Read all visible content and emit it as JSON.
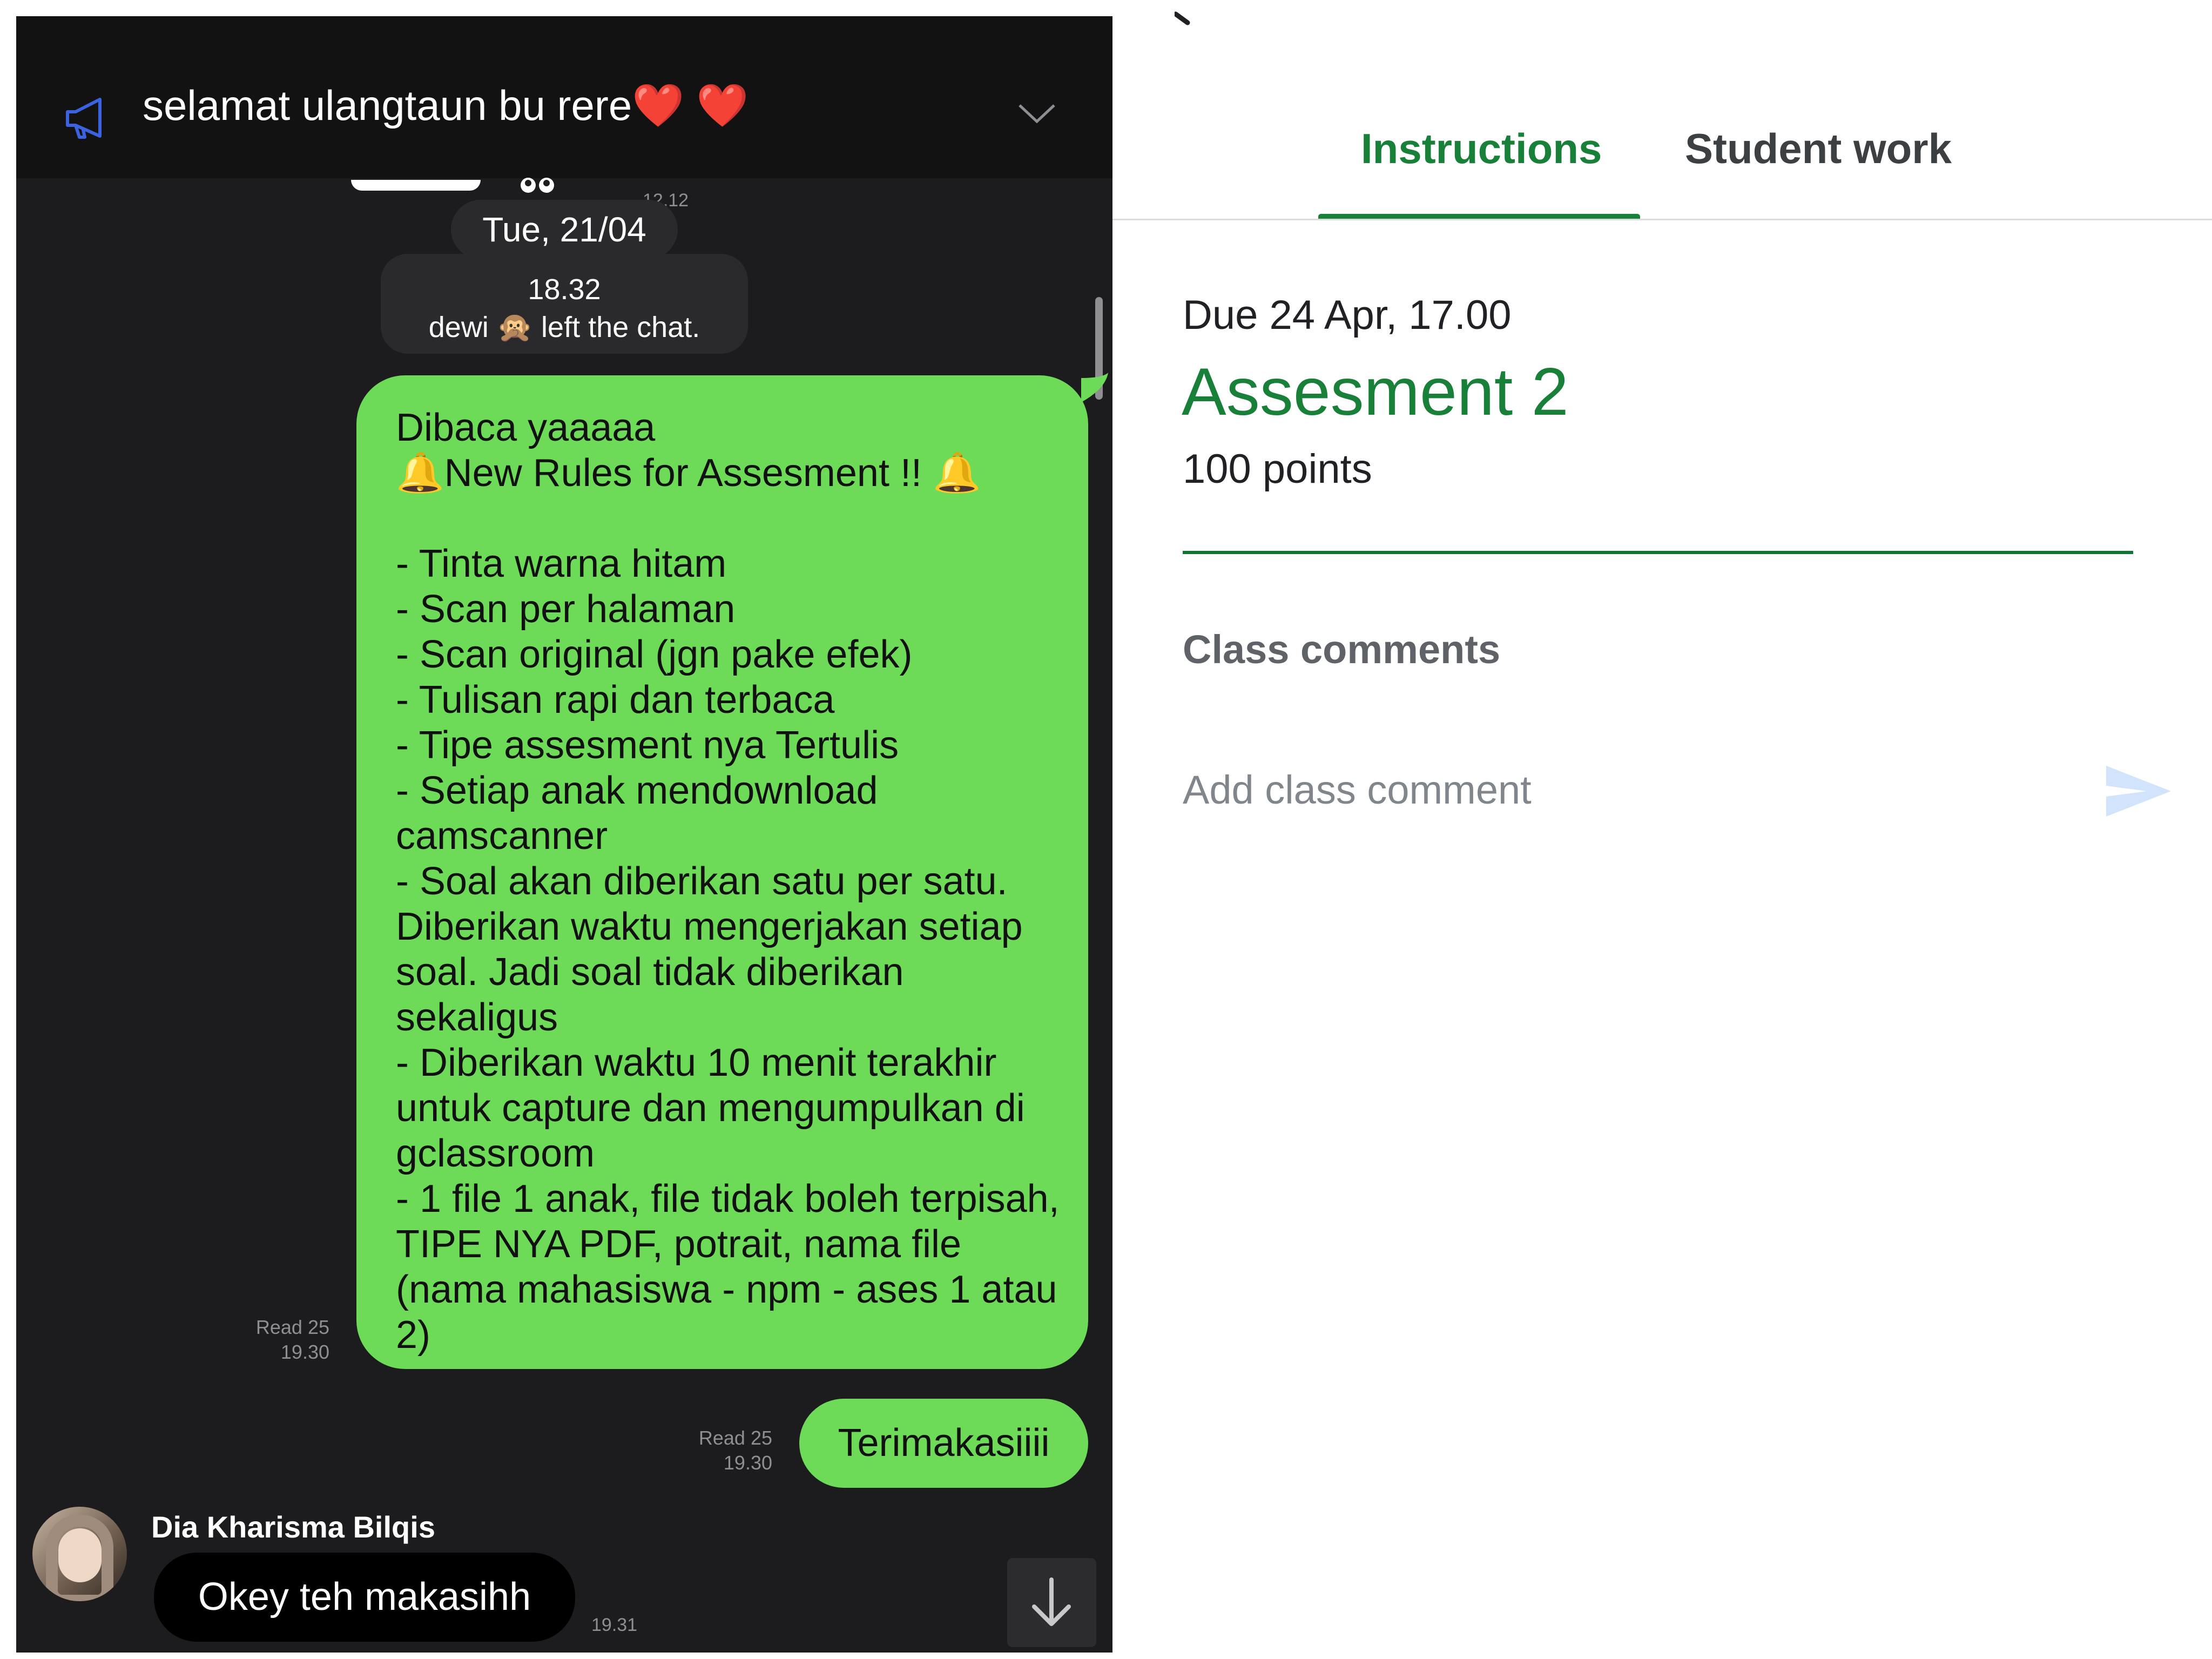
{
  "chat": {
    "announcement": {
      "text": "selamat ulangtaun bu rere",
      "hearts": "❤️ ❤️"
    },
    "sticker_time": "12.12",
    "date_divider": "Tue, 21/04",
    "system_message": {
      "time": "18.32",
      "text": "dewi 🙊 left the chat."
    },
    "messages": [
      {
        "text": "Dibaca yaaaaa\n🔔New Rules for Assesment !! 🔔\n\n- Tinta warna hitam\n- Scan per halaman\n- Scan original (jgn pake efek)\n- Tulisan rapi dan terbaca\n- Tipe assesment nya Tertulis\n- Setiap anak mendownload camscanner\n- Soal akan diberikan satu per satu. Diberikan waktu mengerjakan setiap soal. Jadi soal tidak diberikan sekaligus\n- Diberikan waktu 10 menit terakhir untuk capture dan mengumpulkan di gclassroom\n- 1 file 1 anak, file tidak boleh terpisah, TIPE NYA PDF, potrait, nama file (nama mahasiswa - npm - ases 1 atau 2)",
        "read": "Read 25",
        "time": "19.30"
      },
      {
        "text": "Terimakasiiii",
        "read": "Read 25",
        "time": "19.30"
      }
    ],
    "incoming": {
      "sender": "Dia Kharisma Bilqis",
      "text": "Okey teh makasihh",
      "time": "19.31"
    }
  },
  "classroom": {
    "tabs": [
      "Instructions",
      "Student work"
    ],
    "active_tab": "Instructions",
    "due": "Due 24 Apr, 17.00",
    "title": "Assesment 2",
    "points": "100 points",
    "comments_heading": "Class comments",
    "comment_placeholder": "Add class comment"
  },
  "colors": {
    "chat_bg": "#1c1c1e",
    "bubble_green": "#6ddb57",
    "classroom_green": "#188038"
  }
}
